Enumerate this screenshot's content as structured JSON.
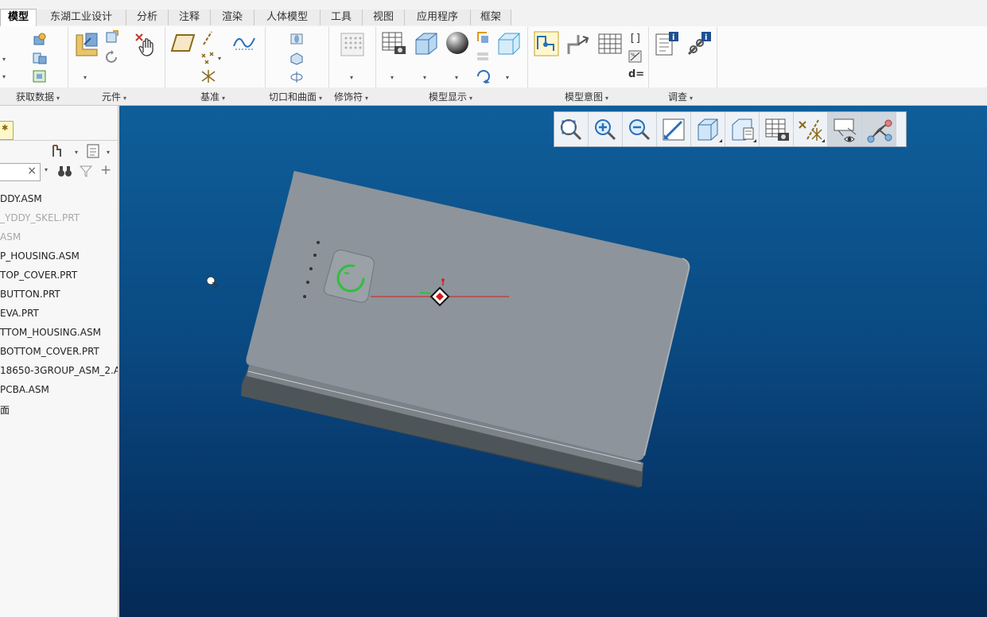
{
  "tabs": [
    "模型",
    "东湖工业设计",
    "分析",
    "注释",
    "渲染",
    "人体模型",
    "工具",
    "视图",
    "应用程序",
    "框架"
  ],
  "active_tab": "模型",
  "ribbon_groups": {
    "get_data": "获取数据",
    "components": "元件",
    "datum": "基准",
    "cut_surface": "切口和曲面",
    "modifiers": "修饰符",
    "model_display": "模型显示",
    "model_intent": "模型意图",
    "investigate": "调查"
  },
  "ribbon_text": {
    "d_equals": "d="
  },
  "model_tree": {
    "items": [
      {
        "label": "DDY.ASM",
        "dim": false
      },
      {
        "label": "_YDDY_SKEL.PRT",
        "dim": true
      },
      {
        "label": "ASM",
        "dim": true
      },
      {
        "label": "P_HOUSING.ASM",
        "dim": false
      },
      {
        "label": "TOP_COVER.PRT",
        "dim": false
      },
      {
        "label": "BUTTON.PRT",
        "dim": false
      },
      {
        "label": "EVA.PRT",
        "dim": false
      },
      {
        "label": "TTOM_HOUSING.ASM",
        "dim": false
      },
      {
        "label": "BOTTOM_COVER.PRT",
        "dim": false
      },
      {
        "label": "18650-3GROUP_ASM_2.A",
        "dim": false
      },
      {
        "label": "PCBA.ASM",
        "dim": false
      },
      {
        "label": "面",
        "dim": false
      }
    ]
  },
  "view_toolbar": [
    "refit-icon",
    "zoom-in-icon",
    "zoom-out-icon",
    "repaint-icon",
    "display-style-icon",
    "saved-views-icon",
    "view-manager-icon",
    "datum-display-icon",
    "annotation-display-icon",
    "spin-center-icon"
  ],
  "colors": {
    "viewport_top": "#0f5e9a",
    "viewport_bottom": "#052a55",
    "model_body": "#8d949b",
    "power_ring": "#2fbf3a"
  }
}
